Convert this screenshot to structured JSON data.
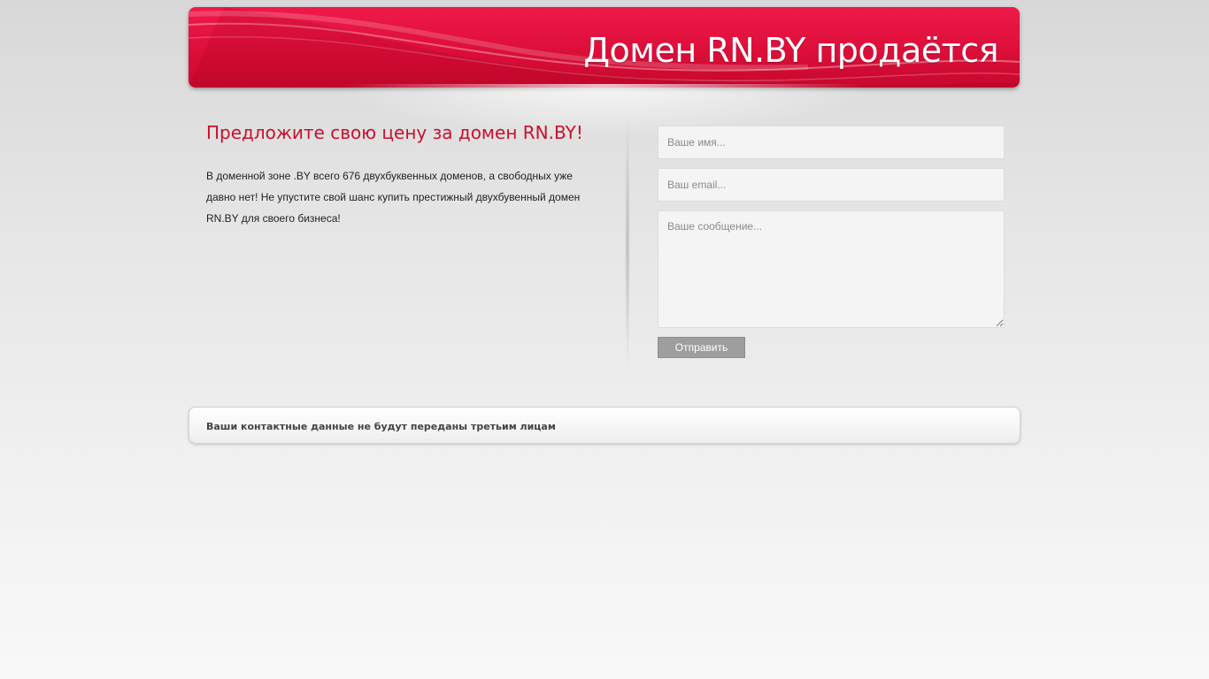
{
  "header": {
    "title": "Домен RN.BY продаётся"
  },
  "offer": {
    "heading": "Предложите свою цену за домен RN.BY!",
    "description": "В доменной зоне .BY всего 676 двухбуквенных доменов, а свободных уже давно нет! Не упустите свой шанс купить престижный двухбувенный домен RN.BY для своего бизнеса!"
  },
  "form": {
    "name_placeholder": "Ваше имя...",
    "email_placeholder": "Ваш email...",
    "message_placeholder": "Ваше сообщение...",
    "submit_label": "Отправить"
  },
  "footer": {
    "notice": "Ваши контактные данные не будут переданы третьим лицам"
  },
  "colors": {
    "brand_red": "#e0103c",
    "heading_red": "#c8102e",
    "button_gray": "#9e9e9e"
  }
}
